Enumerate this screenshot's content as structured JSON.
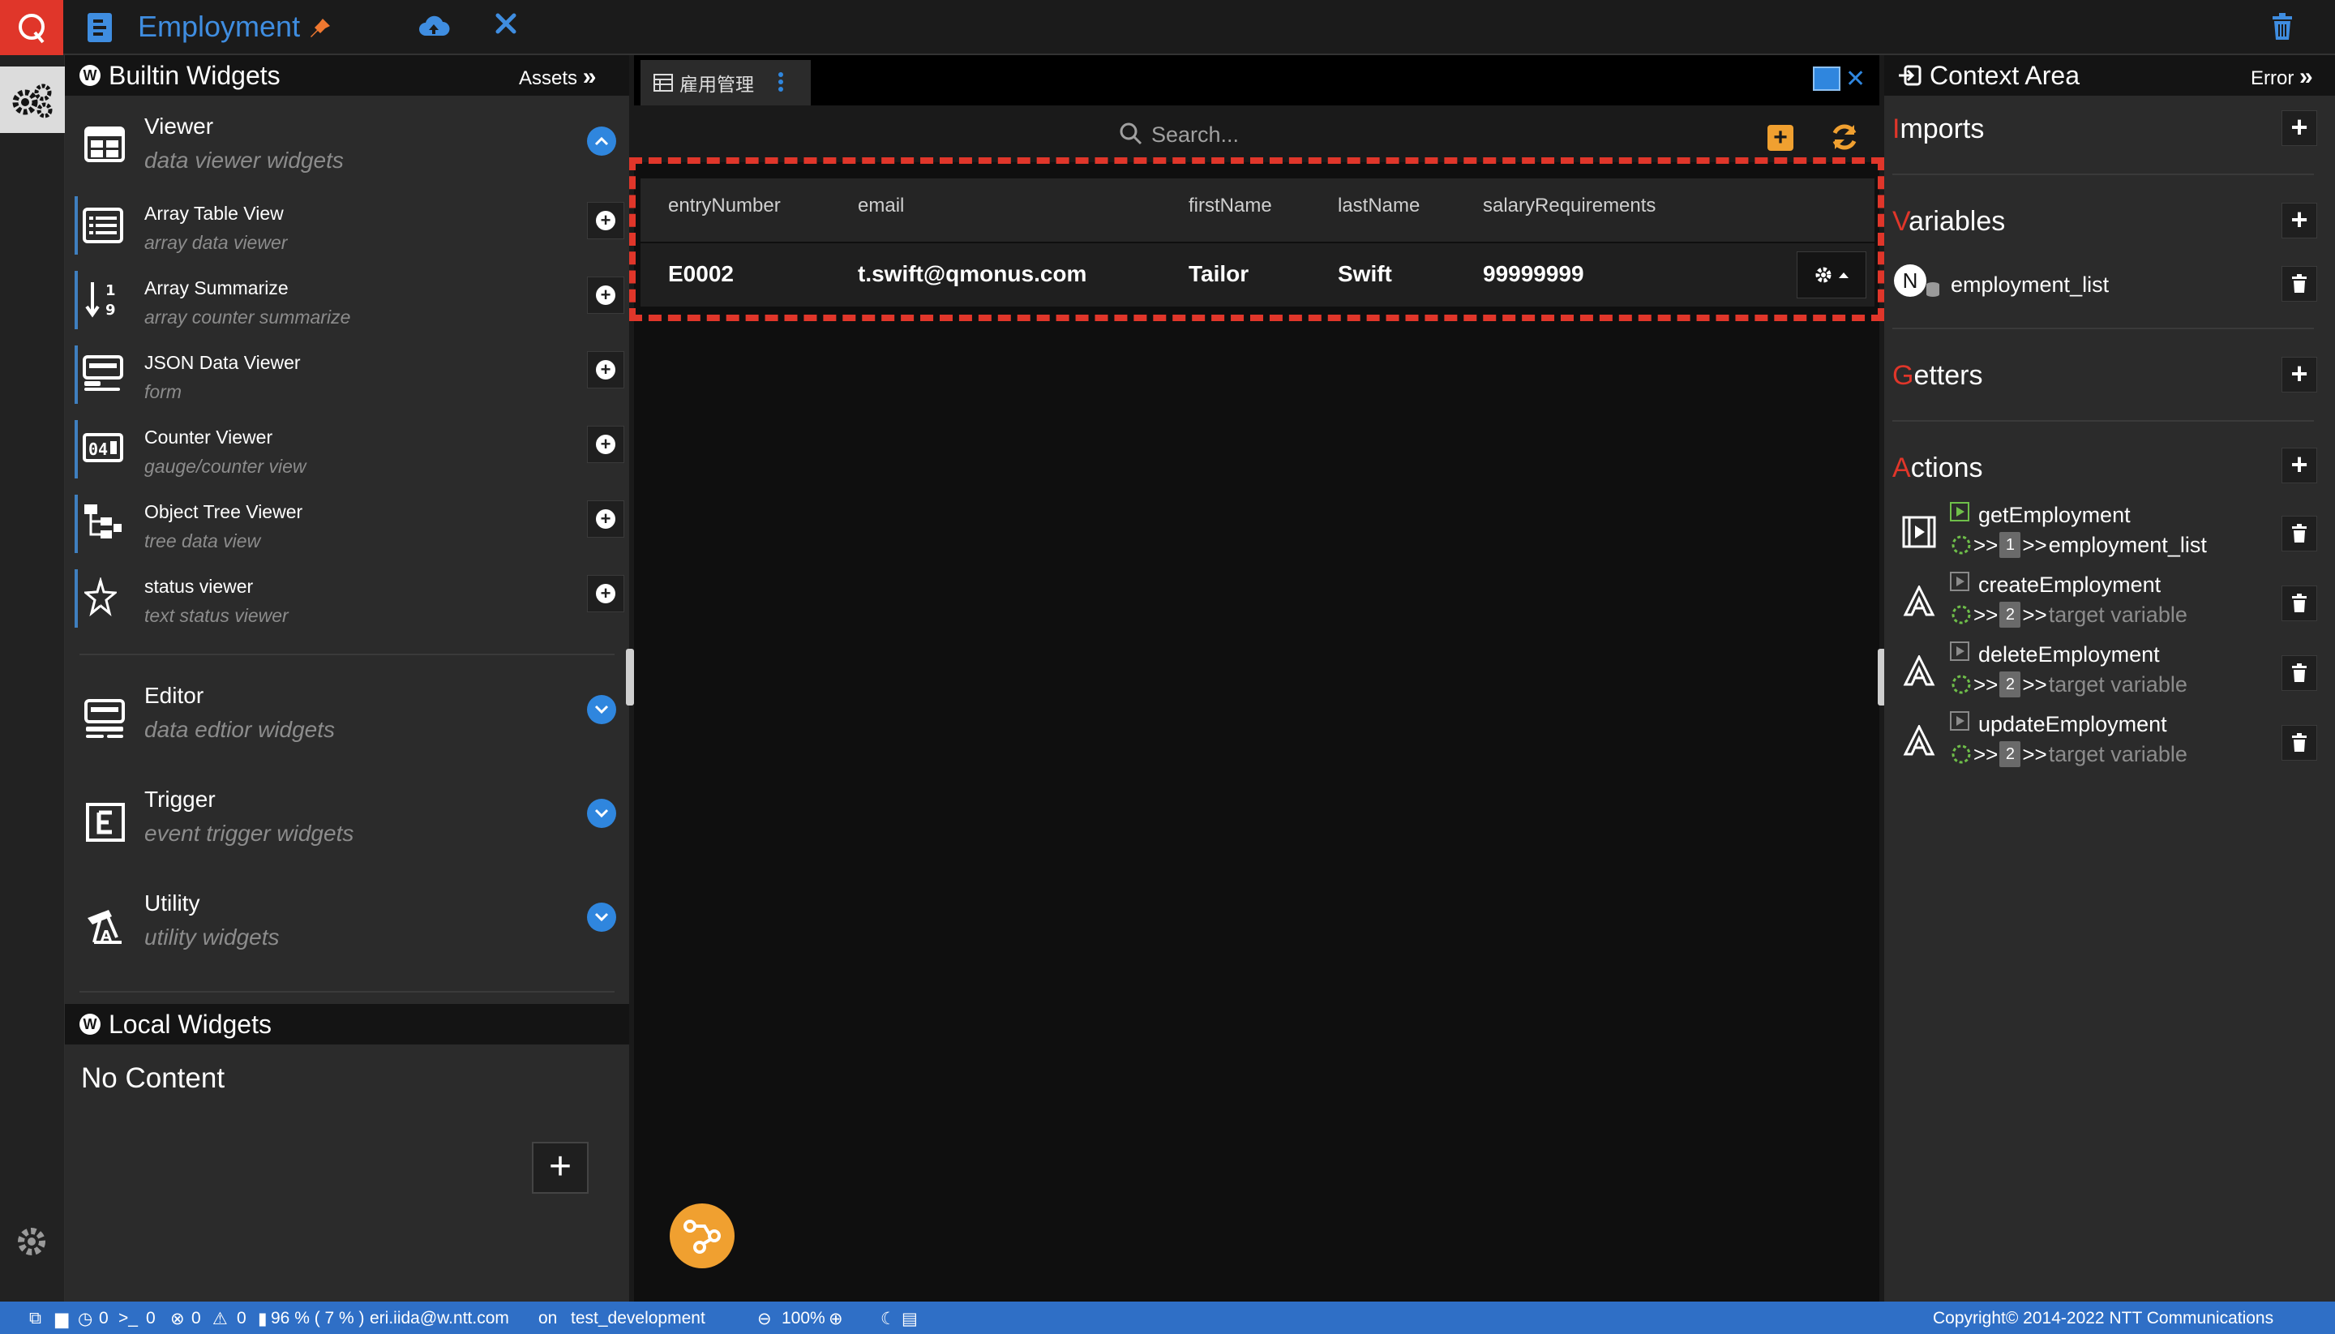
{
  "app": {
    "title": "Employment"
  },
  "left_panel": {
    "title": "Builtin Widgets",
    "assets_label": "Assets",
    "categories": [
      {
        "title": "Viewer",
        "subtitle": "data viewer widgets"
      },
      {
        "title": "Editor",
        "subtitle": "data edtior widgets"
      },
      {
        "title": "Trigger",
        "subtitle": "event trigger widgets"
      },
      {
        "title": "Utility",
        "subtitle": "utility widgets"
      }
    ],
    "viewer_items": [
      {
        "title": "Array Table View",
        "subtitle": "array data viewer",
        "icon": "table-list-icon"
      },
      {
        "title": "Array Summarize",
        "subtitle": "array counter summarize",
        "icon": "sort-numeric-icon"
      },
      {
        "title": "JSON Data Viewer",
        "subtitle": "form",
        "icon": "form-icon"
      },
      {
        "title": "Counter Viewer",
        "subtitle": "gauge/counter view",
        "icon": "counter-icon"
      },
      {
        "title": "Object Tree Viewer",
        "subtitle": "tree data view",
        "icon": "tree-icon"
      },
      {
        "title": "status viewer",
        "subtitle": "text status viewer",
        "icon": "star-half-icon"
      }
    ],
    "local_title": "Local Widgets",
    "local_empty": "No Content"
  },
  "center": {
    "tab_label": "雇用管理",
    "search_placeholder": "Search...",
    "table": {
      "columns": [
        "entryNumber",
        "email",
        "firstName",
        "lastName",
        "salaryRequirements"
      ],
      "rows": [
        [
          "E0002",
          "t.swift@qmonus.com",
          "Tailor",
          "Swift",
          "99999999"
        ]
      ]
    }
  },
  "right_panel": {
    "title": "Context Area",
    "error_label": "Error",
    "sections": {
      "imports": {
        "first": "I",
        "rest": "mports"
      },
      "variables": {
        "first": "V",
        "rest": "ariables"
      },
      "getters": {
        "first": "G",
        "rest": "etters"
      },
      "actions": {
        "first": "A",
        "rest": "ctions"
      }
    },
    "variables": [
      {
        "badge": "N",
        "name": "employment_list"
      }
    ],
    "actions": [
      {
        "name": "getEmployment",
        "count": "1",
        "target": "employment_list",
        "bound": true
      },
      {
        "name": "createEmployment",
        "count": "2",
        "target": "target variable",
        "bound": false
      },
      {
        "name": "deleteEmployment",
        "count": "2",
        "target": "target variable",
        "bound": false
      },
      {
        "name": "updateEmployment",
        "count": "2",
        "target": "target variable",
        "bound": false
      }
    ],
    "arrows": ">>"
  },
  "statusbar": {
    "counter_time": "0",
    "counter_prompt": "0",
    "errors": "0",
    "warnings": "0",
    "memory": "96 % ( 7 % )",
    "user": "eri.iida@w.ntt.com",
    "on_label": "on",
    "environment": "test_development",
    "zoom": "100%",
    "copyright": "Copyright© 2014-2022 NTT Communications"
  },
  "colors": {
    "accent_red": "#e0362a",
    "accent_blue": "#2f86de",
    "accent_orange": "#f0a030",
    "status_bar": "#2f6fc6"
  }
}
